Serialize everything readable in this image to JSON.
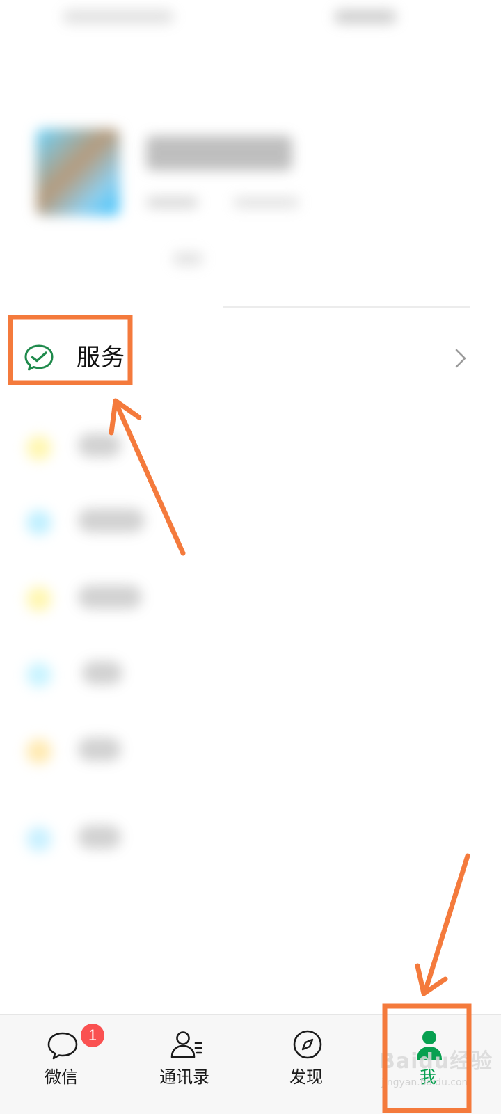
{
  "profile": {
    "service_label": "服务"
  },
  "tabbar": {
    "tabs": [
      {
        "label": "微信",
        "badge": "1"
      },
      {
        "label": "通讯录"
      },
      {
        "label": "发现"
      },
      {
        "label": "我",
        "active": true
      }
    ]
  },
  "watermark": {
    "text": "Baidu经验",
    "sub": "jingyan.baidu.com"
  },
  "colors": {
    "accent_green": "#07a050",
    "badge_red": "#fa5151",
    "annotation_orange": "#f47a3c"
  },
  "icons": {
    "service": "service-check-bubble-icon",
    "chevron": "chevron-right-icon",
    "tab_chats": "chat-bubble-icon",
    "tab_contacts": "contacts-icon",
    "tab_discover": "compass-icon",
    "tab_me": "person-icon"
  }
}
